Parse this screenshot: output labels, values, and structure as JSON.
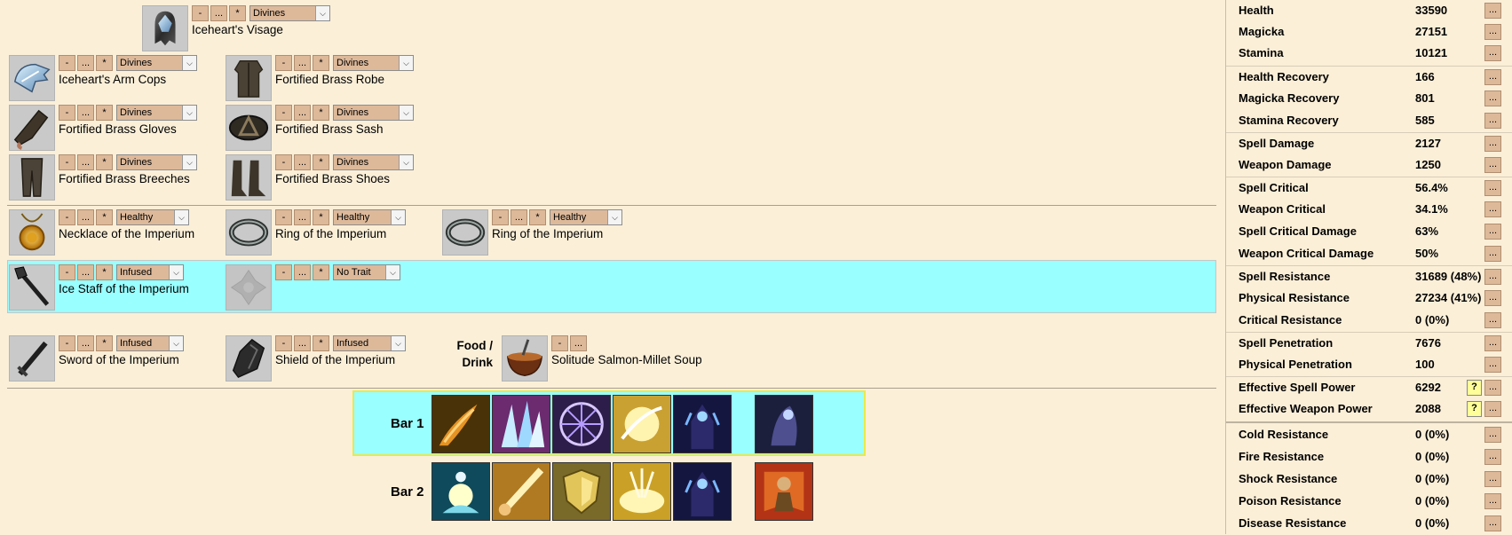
{
  "controls": {
    "minus": "-",
    "more": "...",
    "star": "*"
  },
  "equipment": {
    "head": {
      "name": "Iceheart's Visage",
      "trait": "Divines",
      "icon": "helmet-icon"
    },
    "shoulders": {
      "name": "Iceheart's Arm Cops",
      "trait": "Divines",
      "icon": "shoulder-armor-icon"
    },
    "chest": {
      "name": "Fortified Brass Robe",
      "trait": "Divines",
      "icon": "robe-icon"
    },
    "hands": {
      "name": "Fortified Brass Gloves",
      "trait": "Divines",
      "icon": "gloves-icon"
    },
    "waist": {
      "name": "Fortified Brass Sash",
      "trait": "Divines",
      "icon": "sash-icon"
    },
    "legs": {
      "name": "Fortified Brass Breeches",
      "trait": "Divines",
      "icon": "breeches-icon"
    },
    "feet": {
      "name": "Fortified Brass Shoes",
      "trait": "Divines",
      "icon": "shoes-icon"
    },
    "neck": {
      "name": "Necklace of the Imperium",
      "trait": "Healthy",
      "icon": "necklace-icon"
    },
    "ring1": {
      "name": "Ring of the Imperium",
      "trait": "Healthy",
      "icon": "ring-icon"
    },
    "ring2": {
      "name": "Ring of the Imperium",
      "trait": "Healthy",
      "icon": "ring-icon"
    },
    "main_hand": {
      "name": "Ice Staff of the Imperium",
      "trait": "Infused",
      "icon": "ice-staff-icon"
    },
    "off_hand": {
      "name": "",
      "trait": "No Trait",
      "icon": "empty-slot-icon"
    },
    "backup_main": {
      "name": "Sword of the Imperium",
      "trait": "Infused",
      "icon": "sword-icon"
    },
    "backup_off": {
      "name": "Shield of the Imperium",
      "trait": "Infused",
      "icon": "shield-icon"
    }
  },
  "food": {
    "label": "Food / Drink",
    "name": "Solitude Salmon-Millet Soup",
    "icon": "soup-bowl-icon"
  },
  "bars": {
    "bar1": {
      "label": "Bar 1",
      "skills": [
        "fiery-streak-icon",
        "crystal-shards-icon",
        "arcane-rune-icon",
        "golden-burst-icon",
        "dark-mage-icon"
      ],
      "ultimate": "shadow-cloak-icon"
    },
    "bar2": {
      "label": "Bar 2",
      "skills": [
        "meditation-icon",
        "light-sword-icon",
        "golden-shield-icon",
        "radiant-glow-icon",
        "dark-mage-icon"
      ],
      "ultimate": "warrior-banner-icon"
    }
  },
  "stats": {
    "health": {
      "label": "Health",
      "value": "33590"
    },
    "magicka": {
      "label": "Magicka",
      "value": "27151"
    },
    "stamina": {
      "label": "Stamina",
      "value": "10121"
    },
    "health_recovery": {
      "label": "Health Recovery",
      "value": "166"
    },
    "magicka_recovery": {
      "label": "Magicka Recovery",
      "value": "801"
    },
    "stamina_recovery": {
      "label": "Stamina Recovery",
      "value": "585"
    },
    "spell_damage": {
      "label": "Spell Damage",
      "value": "2127"
    },
    "weapon_damage": {
      "label": "Weapon Damage",
      "value": "1250"
    },
    "spell_critical": {
      "label": "Spell Critical",
      "value": "56.4%"
    },
    "weapon_critical": {
      "label": "Weapon Critical",
      "value": "34.1%"
    },
    "spell_critical_damage": {
      "label": "Spell Critical Damage",
      "value": "63%"
    },
    "weapon_critical_damage": {
      "label": "Weapon Critical Damage",
      "value": "50%"
    },
    "spell_resistance": {
      "label": "Spell Resistance",
      "value": "31689 (48%)"
    },
    "physical_resistance": {
      "label": "Physical Resistance",
      "value": "27234 (41%)"
    },
    "critical_resistance": {
      "label": "Critical Resistance",
      "value": "0 (0%)"
    },
    "spell_penetration": {
      "label": "Spell Penetration",
      "value": "7676"
    },
    "physical_penetration": {
      "label": "Physical Penetration",
      "value": "100"
    },
    "effective_spell_power": {
      "label": "Effective Spell Power",
      "value": "6292"
    },
    "effective_weapon_power": {
      "label": "Effective Weapon Power",
      "value": "2088"
    },
    "cold_resistance": {
      "label": "Cold Resistance",
      "value": "0 (0%)"
    },
    "fire_resistance": {
      "label": "Fire Resistance",
      "value": "0 (0%)"
    },
    "shock_resistance": {
      "label": "Shock Resistance",
      "value": "0 (0%)"
    },
    "poison_resistance": {
      "label": "Poison Resistance",
      "value": "0 (0%)"
    },
    "disease_resistance": {
      "label": "Disease Resistance",
      "value": "0 (0%)"
    }
  },
  "stat_button": "...",
  "help_button": "?",
  "colors": {
    "background": "#fbefd8",
    "highlight": "#99ffff",
    "button": "#ddb99a",
    "bar_border": "#e9e94c",
    "help": "#ffff99"
  }
}
